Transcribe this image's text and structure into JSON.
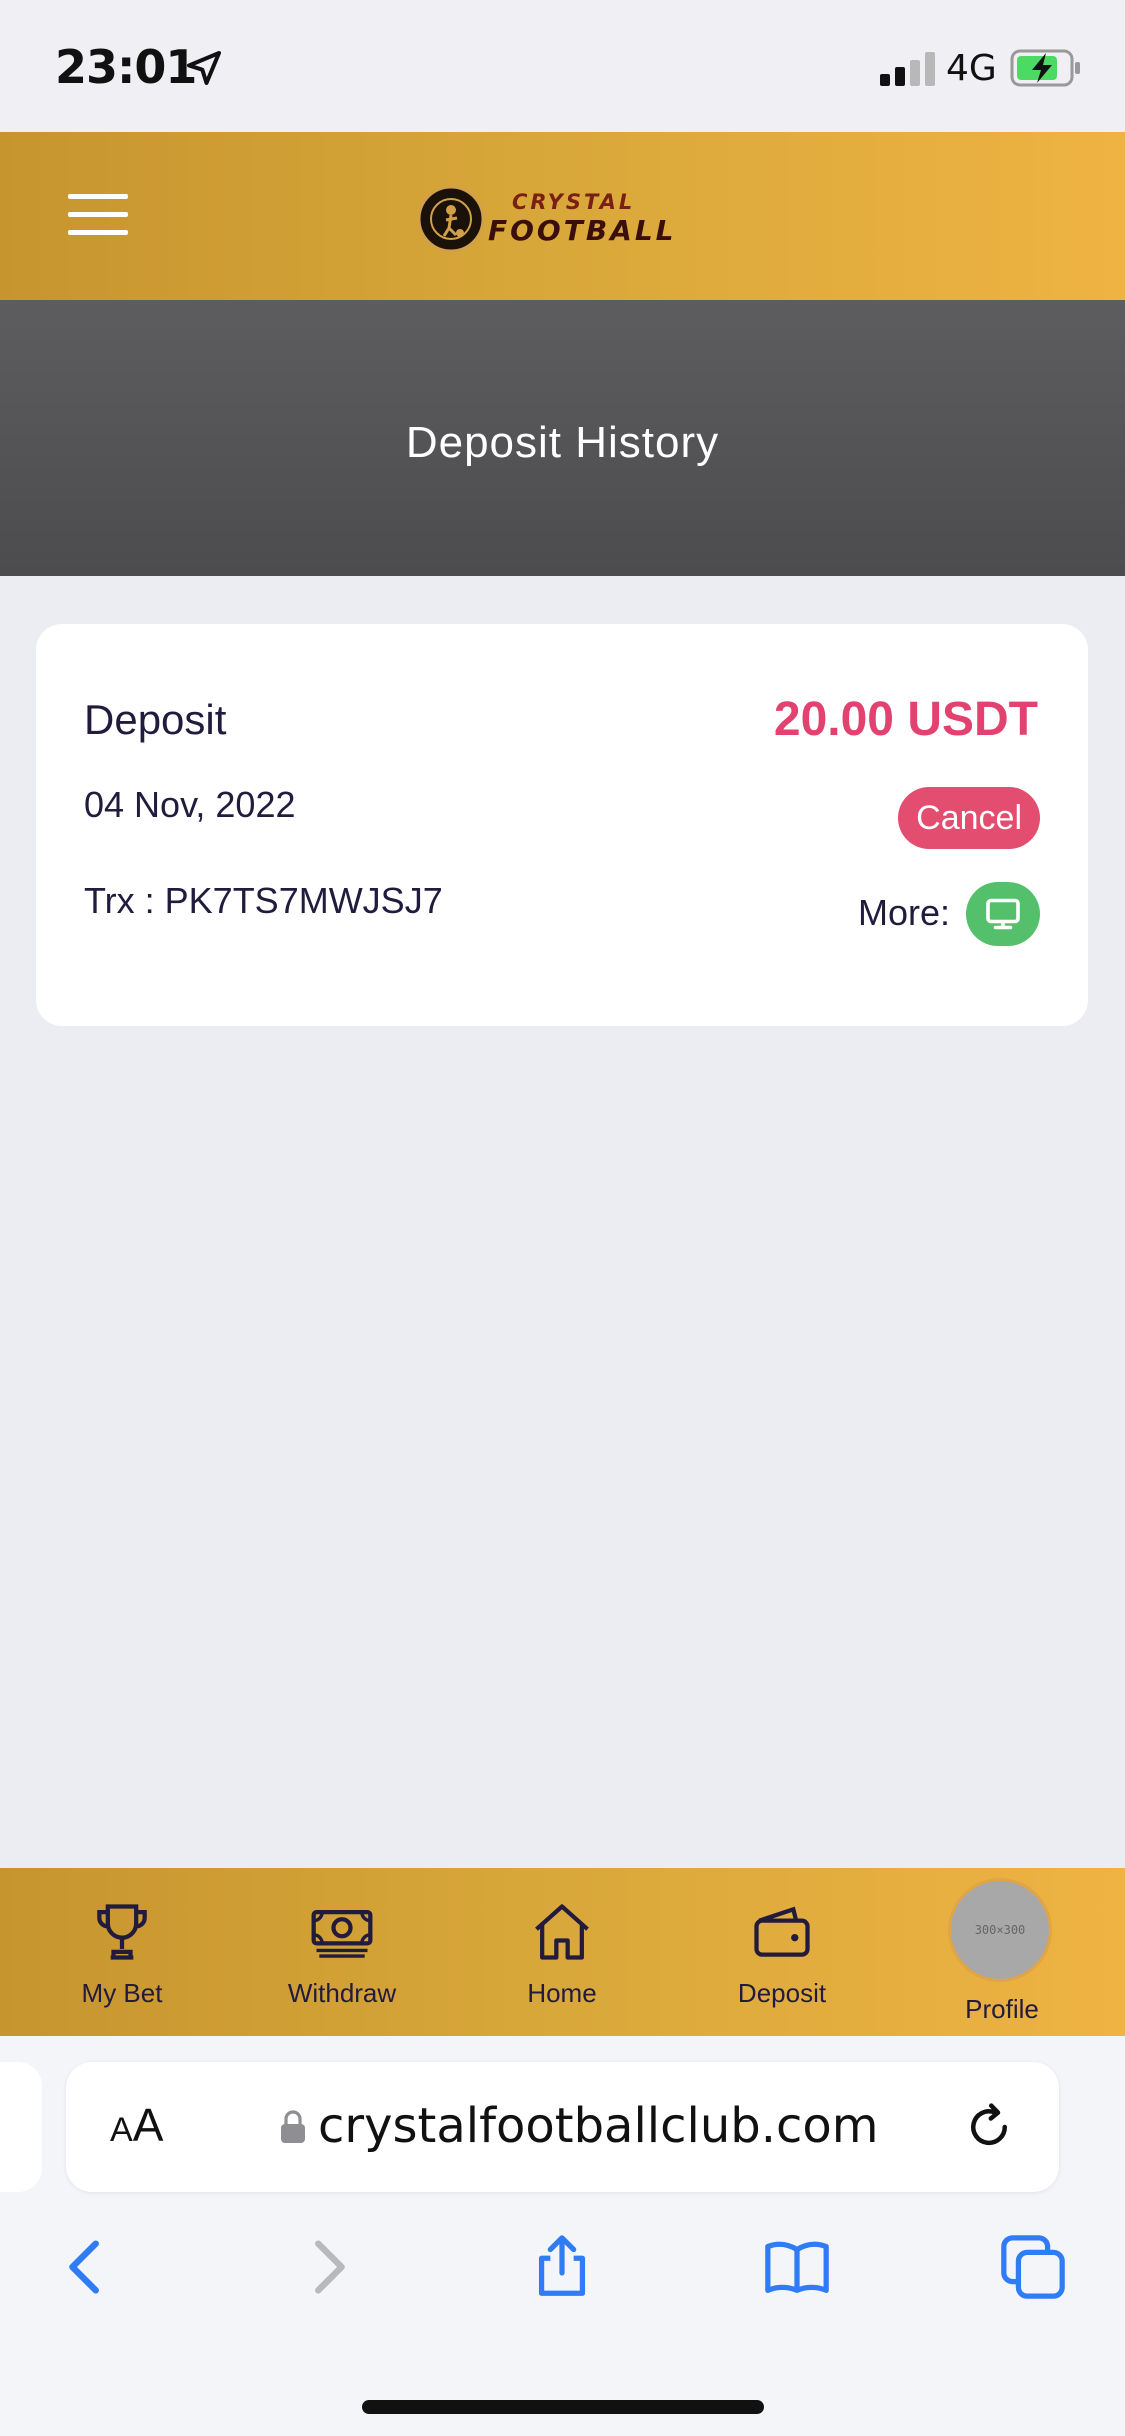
{
  "status_bar": {
    "time": "23:01",
    "network": "4G"
  },
  "header": {
    "logo_line1": "CRYSTAL",
    "logo_line2": "FOOTBALL",
    "logo_badge": "CRYSTAL FOOTBALL"
  },
  "hero": {
    "title": "Deposit History"
  },
  "deposit": {
    "type": "Deposit",
    "amount": "20.00 USDT",
    "date": "04 Nov, 2022",
    "trx": "Trx : PK7TS7MWJSJ7",
    "cancel_label": "Cancel",
    "more_label": "More:"
  },
  "bottom_nav": [
    {
      "label": "My Bet",
      "icon": "trophy-icon"
    },
    {
      "label": "Withdraw",
      "icon": "money-icon"
    },
    {
      "label": "Home",
      "icon": "home-icon"
    },
    {
      "label": "Deposit",
      "icon": "wallet-icon"
    },
    {
      "label": "Profile",
      "icon": "avatar",
      "avatar_placeholder": "300×300"
    }
  ],
  "browser": {
    "aa_label_small": "A",
    "aa_label_large": "A",
    "url": "crystalfootballclub.com"
  },
  "colors": {
    "gold": "#d9a83a",
    "accent_pink": "#e2426f",
    "more_green": "#55c06b",
    "text_dark": "#221b3d"
  }
}
